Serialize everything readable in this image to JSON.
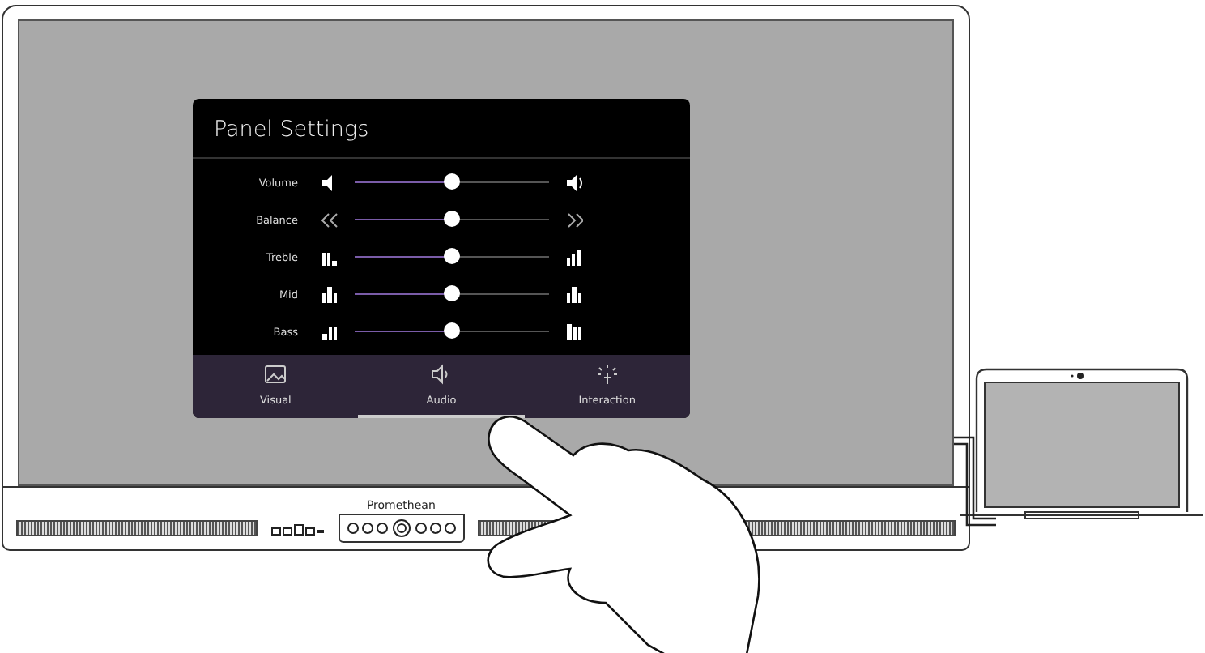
{
  "dialog": {
    "title": "Panel Settings",
    "sliders": [
      {
        "label": "Volume",
        "kind": "volume",
        "level": 0.5
      },
      {
        "label": "Balance",
        "kind": "balance",
        "level": 0.5
      },
      {
        "label": "Treble",
        "kind": "treble",
        "level": 0.5
      },
      {
        "label": "Mid",
        "kind": "mid",
        "level": 0.5
      },
      {
        "label": "Bass",
        "kind": "bass",
        "level": 0.5
      }
    ],
    "tabs": [
      {
        "label": "Visual",
        "kind": "visual",
        "selected": false
      },
      {
        "label": "Audio",
        "kind": "audio",
        "selected": true
      },
      {
        "label": "Interaction",
        "kind": "interaction",
        "selected": false
      }
    ]
  },
  "panel": {
    "brand": "Promethean"
  }
}
